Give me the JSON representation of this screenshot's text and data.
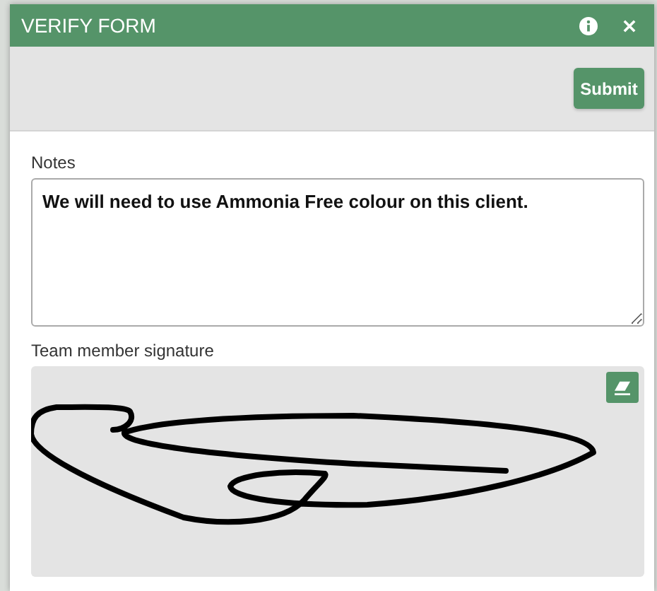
{
  "window": {
    "title": "VERIFY FORM"
  },
  "toolbar": {
    "submit_button": "Submit"
  },
  "notes": {
    "label": "Notes",
    "value": "We will need to use Ammonia Free colour on this client."
  },
  "signature": {
    "label": "Team member signature"
  }
}
